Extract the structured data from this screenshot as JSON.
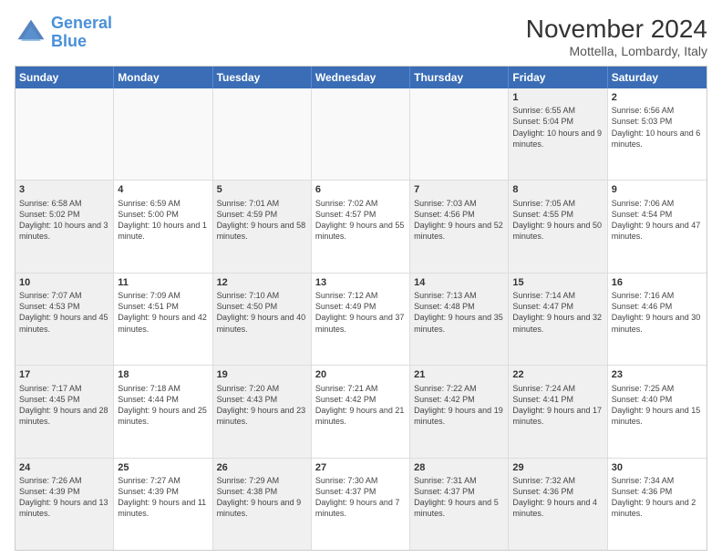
{
  "header": {
    "logo_general": "General",
    "logo_blue": "Blue",
    "month_title": "November 2024",
    "location": "Mottella, Lombardy, Italy"
  },
  "calendar": {
    "days_of_week": [
      "Sunday",
      "Monday",
      "Tuesday",
      "Wednesday",
      "Thursday",
      "Friday",
      "Saturday"
    ],
    "rows": [
      [
        {
          "day": "",
          "info": "",
          "empty": true
        },
        {
          "day": "",
          "info": "",
          "empty": true
        },
        {
          "day": "",
          "info": "",
          "empty": true
        },
        {
          "day": "",
          "info": "",
          "empty": true
        },
        {
          "day": "",
          "info": "",
          "empty": true
        },
        {
          "day": "1",
          "info": "Sunrise: 6:55 AM\nSunset: 5:04 PM\nDaylight: 10 hours and 9 minutes.",
          "shaded": true
        },
        {
          "day": "2",
          "info": "Sunrise: 6:56 AM\nSunset: 5:03 PM\nDaylight: 10 hours and 6 minutes.",
          "shaded": false
        }
      ],
      [
        {
          "day": "3",
          "info": "Sunrise: 6:58 AM\nSunset: 5:02 PM\nDaylight: 10 hours and 3 minutes.",
          "shaded": true
        },
        {
          "day": "4",
          "info": "Sunrise: 6:59 AM\nSunset: 5:00 PM\nDaylight: 10 hours and 1 minute.",
          "shaded": false
        },
        {
          "day": "5",
          "info": "Sunrise: 7:01 AM\nSunset: 4:59 PM\nDaylight: 9 hours and 58 minutes.",
          "shaded": true
        },
        {
          "day": "6",
          "info": "Sunrise: 7:02 AM\nSunset: 4:57 PM\nDaylight: 9 hours and 55 minutes.",
          "shaded": false
        },
        {
          "day": "7",
          "info": "Sunrise: 7:03 AM\nSunset: 4:56 PM\nDaylight: 9 hours and 52 minutes.",
          "shaded": true
        },
        {
          "day": "8",
          "info": "Sunrise: 7:05 AM\nSunset: 4:55 PM\nDaylight: 9 hours and 50 minutes.",
          "shaded": true
        },
        {
          "day": "9",
          "info": "Sunrise: 7:06 AM\nSunset: 4:54 PM\nDaylight: 9 hours and 47 minutes.",
          "shaded": false
        }
      ],
      [
        {
          "day": "10",
          "info": "Sunrise: 7:07 AM\nSunset: 4:53 PM\nDaylight: 9 hours and 45 minutes.",
          "shaded": true
        },
        {
          "day": "11",
          "info": "Sunrise: 7:09 AM\nSunset: 4:51 PM\nDaylight: 9 hours and 42 minutes.",
          "shaded": false
        },
        {
          "day": "12",
          "info": "Sunrise: 7:10 AM\nSunset: 4:50 PM\nDaylight: 9 hours and 40 minutes.",
          "shaded": true
        },
        {
          "day": "13",
          "info": "Sunrise: 7:12 AM\nSunset: 4:49 PM\nDaylight: 9 hours and 37 minutes.",
          "shaded": false
        },
        {
          "day": "14",
          "info": "Sunrise: 7:13 AM\nSunset: 4:48 PM\nDaylight: 9 hours and 35 minutes.",
          "shaded": true
        },
        {
          "day": "15",
          "info": "Sunrise: 7:14 AM\nSunset: 4:47 PM\nDaylight: 9 hours and 32 minutes.",
          "shaded": true
        },
        {
          "day": "16",
          "info": "Sunrise: 7:16 AM\nSunset: 4:46 PM\nDaylight: 9 hours and 30 minutes.",
          "shaded": false
        }
      ],
      [
        {
          "day": "17",
          "info": "Sunrise: 7:17 AM\nSunset: 4:45 PM\nDaylight: 9 hours and 28 minutes.",
          "shaded": true
        },
        {
          "day": "18",
          "info": "Sunrise: 7:18 AM\nSunset: 4:44 PM\nDaylight: 9 hours and 25 minutes.",
          "shaded": false
        },
        {
          "day": "19",
          "info": "Sunrise: 7:20 AM\nSunset: 4:43 PM\nDaylight: 9 hours and 23 minutes.",
          "shaded": true
        },
        {
          "day": "20",
          "info": "Sunrise: 7:21 AM\nSunset: 4:42 PM\nDaylight: 9 hours and 21 minutes.",
          "shaded": false
        },
        {
          "day": "21",
          "info": "Sunrise: 7:22 AM\nSunset: 4:42 PM\nDaylight: 9 hours and 19 minutes.",
          "shaded": true
        },
        {
          "day": "22",
          "info": "Sunrise: 7:24 AM\nSunset: 4:41 PM\nDaylight: 9 hours and 17 minutes.",
          "shaded": true
        },
        {
          "day": "23",
          "info": "Sunrise: 7:25 AM\nSunset: 4:40 PM\nDaylight: 9 hours and 15 minutes.",
          "shaded": false
        }
      ],
      [
        {
          "day": "24",
          "info": "Sunrise: 7:26 AM\nSunset: 4:39 PM\nDaylight: 9 hours and 13 minutes.",
          "shaded": true
        },
        {
          "day": "25",
          "info": "Sunrise: 7:27 AM\nSunset: 4:39 PM\nDaylight: 9 hours and 11 minutes.",
          "shaded": false
        },
        {
          "day": "26",
          "info": "Sunrise: 7:29 AM\nSunset: 4:38 PM\nDaylight: 9 hours and 9 minutes.",
          "shaded": true
        },
        {
          "day": "27",
          "info": "Sunrise: 7:30 AM\nSunset: 4:37 PM\nDaylight: 9 hours and 7 minutes.",
          "shaded": false
        },
        {
          "day": "28",
          "info": "Sunrise: 7:31 AM\nSunset: 4:37 PM\nDaylight: 9 hours and 5 minutes.",
          "shaded": true
        },
        {
          "day": "29",
          "info": "Sunrise: 7:32 AM\nSunset: 4:36 PM\nDaylight: 9 hours and 4 minutes.",
          "shaded": true
        },
        {
          "day": "30",
          "info": "Sunrise: 7:34 AM\nSunset: 4:36 PM\nDaylight: 9 hours and 2 minutes.",
          "shaded": false
        }
      ]
    ]
  }
}
